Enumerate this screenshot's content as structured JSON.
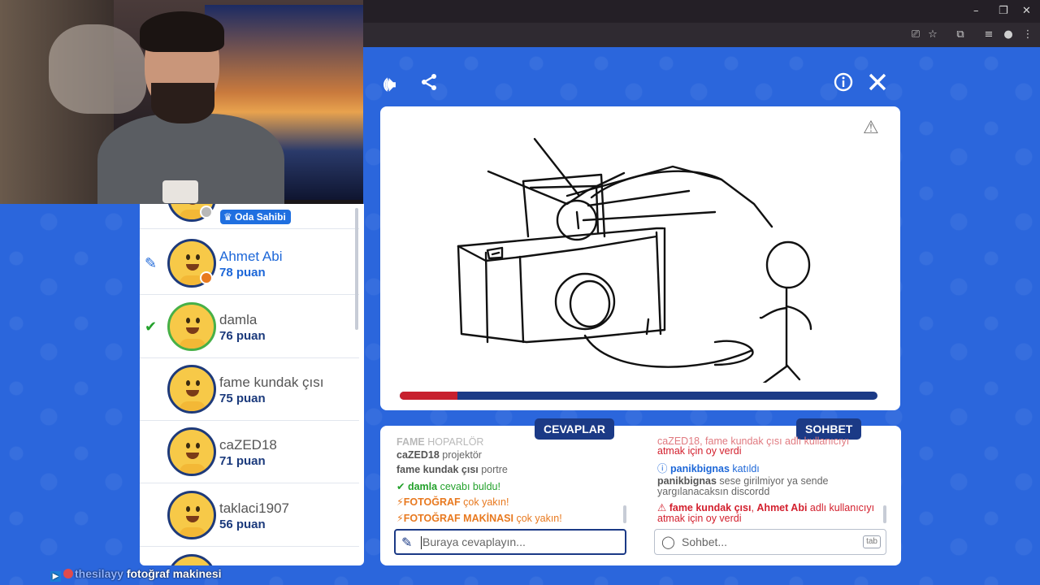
{
  "browser": {
    "window_controls": [
      "–",
      "❐",
      "✕"
    ]
  },
  "stream": {
    "username": "thesilayy",
    "message": "fotoğraf makinesi"
  },
  "players_panel": {
    "owner_badge": "Oda Sahibi",
    "players": [
      {
        "name": "Ahmet Abi",
        "score": "78 puan",
        "state": "drawing"
      },
      {
        "name": "damla",
        "score": "76 puan",
        "state": "guessed"
      },
      {
        "name": "fame kundak çısı",
        "score": "75 puan",
        "state": "none"
      },
      {
        "name": "caZED18",
        "score": "71 puan",
        "state": "none"
      },
      {
        "name": "taklaci1907",
        "score": "56 puan",
        "state": "none"
      }
    ]
  },
  "toolbar": {
    "sound_icon": "speaker-icon",
    "share_icon": "share-icon",
    "info_icon": "info-icon",
    "close_icon": "close-icon"
  },
  "canvas": {
    "report_icon": "warning-icon",
    "timer_remaining_fraction": 0.12,
    "timer_colors": {
      "track": "#1b3a86",
      "fill": "#c7202e"
    }
  },
  "answers": {
    "tab_label": "CEVAPLAR",
    "messages": [
      {
        "user": "FAME",
        "text": "HOPARLÖR",
        "style": "faded"
      },
      {
        "user": "caZED18",
        "text": "projektör",
        "style": "normal"
      },
      {
        "user": "fame kundak çısı",
        "text": "portre",
        "style": "normal"
      },
      {
        "user": "damla",
        "text": "cevabı buldu!",
        "style": "found"
      },
      {
        "user": "FOTOĞRAF",
        "text": "çok yakın!",
        "style": "close"
      },
      {
        "user": "FOTOĞRAF MAKİNASI",
        "text": "çok yakın!",
        "style": "close"
      }
    ],
    "input_placeholder": "Buraya cevaplayın..."
  },
  "chat": {
    "tab_label": "SOHBET",
    "messages": [
      {
        "line1": "caZED18, fame kundak çısı adlı kullanıcıyı",
        "line2": "atmak için oy verdi",
        "style": "vote-faded"
      },
      {
        "user": "panikbignas",
        "text": "katıldı",
        "style": "join"
      },
      {
        "user": "panikbignas",
        "line1": "sese girilmiyor ya sende",
        "line2": "yargılanacaksın discordd",
        "style": "normal"
      },
      {
        "user1": "fame kundak çısı",
        "sep": ", ",
        "user2": "Ahmet Abi",
        "line1": " adlı kullanıcıyı",
        "line2": "atmak için oy verdi",
        "style": "vote"
      }
    ],
    "input_placeholder": "Sohbet...",
    "tab_hint": "tab"
  },
  "brand_colors": {
    "background": "#2b66dc",
    "navy": "#1b3a86",
    "accent_blue": "#1d67d8",
    "green": "#23a12b",
    "orange": "#e8791f",
    "red": "#d3202e"
  }
}
